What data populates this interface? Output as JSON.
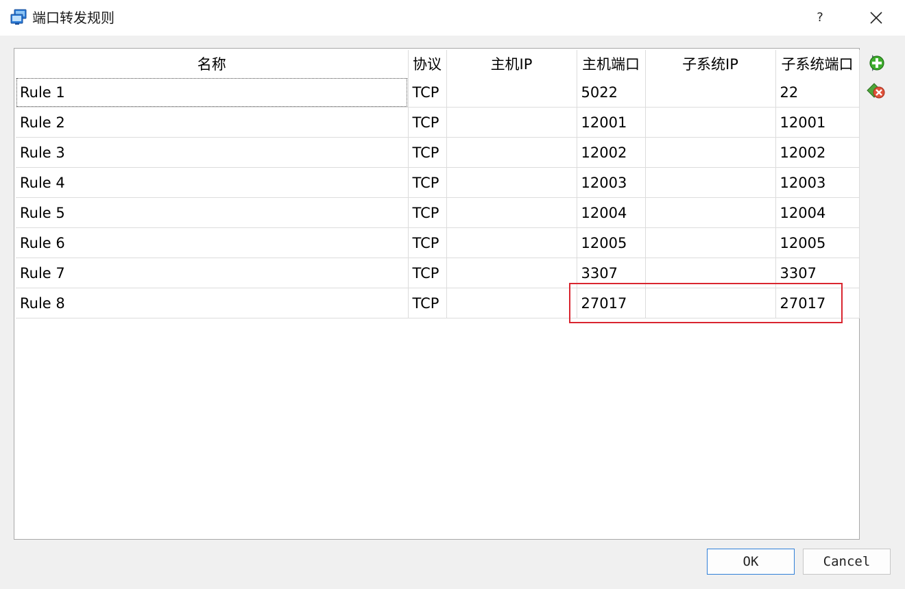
{
  "window": {
    "title": "端口转发规则",
    "help_label": "?"
  },
  "table": {
    "columns": [
      "名称",
      "协议",
      "主机IP",
      "主机端口",
      "子系统IP",
      "子系统端口"
    ],
    "rows": [
      [
        "Rule 1",
        "TCP",
        "",
        "5022",
        "",
        "22"
      ],
      [
        "Rule 2",
        "TCP",
        "",
        "12001",
        "",
        "12001"
      ],
      [
        "Rule 3",
        "TCP",
        "",
        "12002",
        "",
        "12002"
      ],
      [
        "Rule 4",
        "TCP",
        "",
        "12003",
        "",
        "12003"
      ],
      [
        "Rule 5",
        "TCP",
        "",
        "12004",
        "",
        "12004"
      ],
      [
        "Rule 6",
        "TCP",
        "",
        "12005",
        "",
        "12005"
      ],
      [
        "Rule 7",
        "TCP",
        "",
        "3307",
        "",
        "3307"
      ],
      [
        "Rule 8",
        "TCP",
        "",
        "27017",
        "",
        "27017"
      ]
    ]
  },
  "side_actions": {
    "add_icon": "add-rule-icon",
    "remove_icon": "remove-rule-icon"
  },
  "buttons": {
    "ok": "OK",
    "cancel": "Cancel"
  },
  "colors": {
    "highlight": "#d9252f",
    "ok_border": "#2f7fd8"
  }
}
